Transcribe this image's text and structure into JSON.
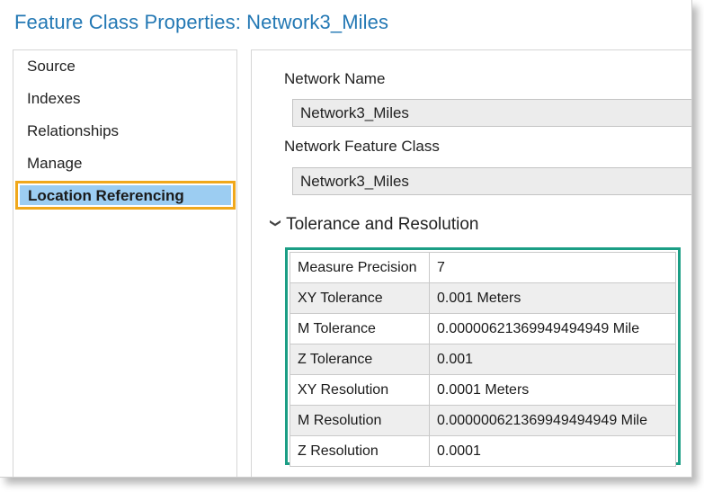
{
  "window": {
    "title": "Feature Class Properties: Network3_Miles"
  },
  "sidebar": {
    "items": [
      {
        "label": "Source",
        "active": false
      },
      {
        "label": "Indexes",
        "active": false
      },
      {
        "label": "Relationships",
        "active": false
      },
      {
        "label": "Manage",
        "active": false
      },
      {
        "label": "Location Referencing",
        "active": true
      }
    ]
  },
  "main": {
    "network_name": {
      "label": "Network Name",
      "value": "Network3_Miles"
    },
    "network_feature_class": {
      "label": "Network Feature Class",
      "value": "Network3_Miles"
    },
    "section": {
      "title": "Tolerance and Resolution",
      "expanded": true,
      "icon": "chevron-down-icon"
    },
    "properties": [
      {
        "name": "Measure Precision",
        "value": "7"
      },
      {
        "name": "XY Tolerance",
        "value": "0.001 Meters"
      },
      {
        "name": "M Tolerance",
        "value": "0.00000621369949494949 Mile"
      },
      {
        "name": "Z Tolerance",
        "value": "0.001"
      },
      {
        "name": "XY Resolution",
        "value": "0.0001 Meters"
      },
      {
        "name": "M Resolution",
        "value": "0.000000621369949494949 Mile"
      },
      {
        "name": "Z Resolution",
        "value": "0.0001"
      }
    ]
  },
  "colors": {
    "title": "#2378b4",
    "selection_fill": "#9ccdf2",
    "selection_highlight": "#f0a81c",
    "grid_highlight": "#1b9e85"
  }
}
